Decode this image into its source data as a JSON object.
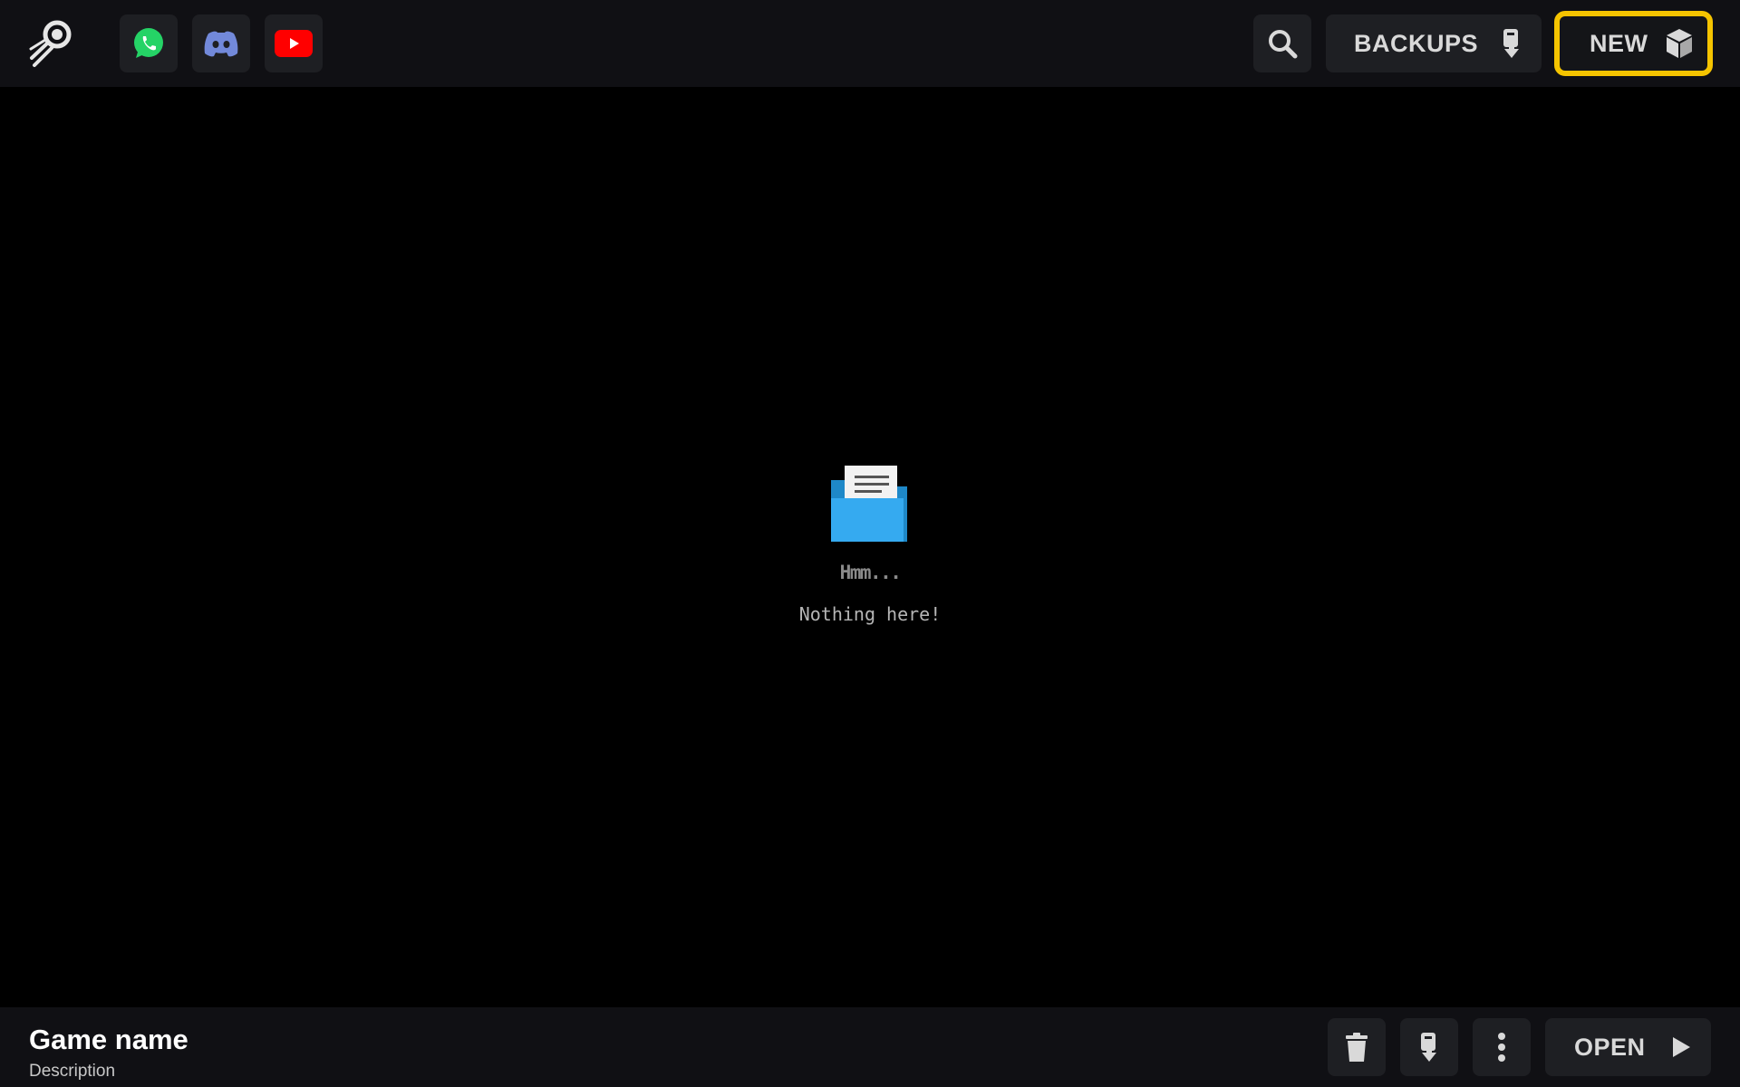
{
  "topbar": {
    "logo_icon": "comet-logo-icon",
    "social": [
      {
        "name": "whatsapp",
        "icon": "whatsapp-icon",
        "color": "#25d366"
      },
      {
        "name": "discord",
        "icon": "discord-icon",
        "color": "#7289da"
      },
      {
        "name": "youtube",
        "icon": "youtube-icon",
        "color": "#ff0000"
      }
    ],
    "search_icon": "search-icon",
    "backups_label": "BACKUPS",
    "backups_icon": "download-icon",
    "new_label": "NEW",
    "new_icon": "cube-icon",
    "highlight_color": "#f5c400"
  },
  "empty_state": {
    "icon": "open-folder-icon",
    "title": "Hmm...",
    "message": "Nothing here!"
  },
  "bottombar": {
    "game_name": "Game name",
    "description": "Description",
    "delete_icon": "trash-icon",
    "backup_icon": "download-icon",
    "more_icon": "more-vertical-icon",
    "open_label": "OPEN",
    "open_icon": "play-icon"
  }
}
